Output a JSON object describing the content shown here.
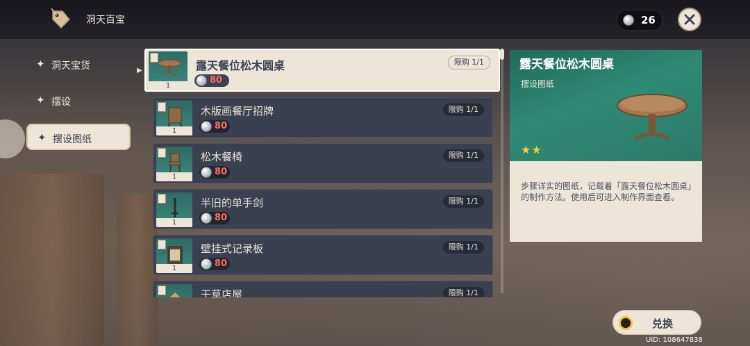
{
  "header": {
    "title": "洞天百宝",
    "currency_count": "26"
  },
  "tabs": [
    {
      "label": "洞天宝货",
      "selected": false
    },
    {
      "label": "摆设",
      "selected": false
    },
    {
      "label": "摆设图纸",
      "selected": true
    }
  ],
  "items": [
    {
      "name": "露天餐位松木圆桌",
      "price": "80",
      "limit": "限购 1/1",
      "quantity": "1",
      "selected": true,
      "icon": "round-table-icon"
    },
    {
      "name": "木版画餐厅招牌",
      "price": "80",
      "limit": "限购 1/1",
      "quantity": "1",
      "selected": false,
      "icon": "signboard-icon"
    },
    {
      "name": "松木餐椅",
      "price": "80",
      "limit": "限购 1/1",
      "quantity": "1",
      "selected": false,
      "icon": "chair-icon"
    },
    {
      "name": "半旧的单手剑",
      "price": "80",
      "limit": "限购 1/1",
      "quantity": "1",
      "selected": false,
      "icon": "sword-icon"
    },
    {
      "name": "壁挂式记录板",
      "price": "80",
      "limit": "限购 1/1",
      "quantity": "1",
      "selected": false,
      "icon": "board-icon"
    },
    {
      "name": "干草店屋",
      "price": "",
      "limit": "限购 1/1",
      "quantity": "",
      "selected": false,
      "icon": "hut-icon"
    }
  ],
  "detail": {
    "name": "露天餐位松木圆桌",
    "category": "摆设图纸",
    "rarity": "★★",
    "description": "步骤详实的图纸，记载着「露天餐位松木圆桌」的制作方法。使用后可进入制作界面查看。"
  },
  "redeem": {
    "label": "兑换"
  },
  "uid": "UID: 108647838",
  "colors": {
    "accent_green": "#2f8a74",
    "cream": "#ece5d8",
    "price_red": "#ff6a5a",
    "dark_panel": "#3a4050"
  }
}
